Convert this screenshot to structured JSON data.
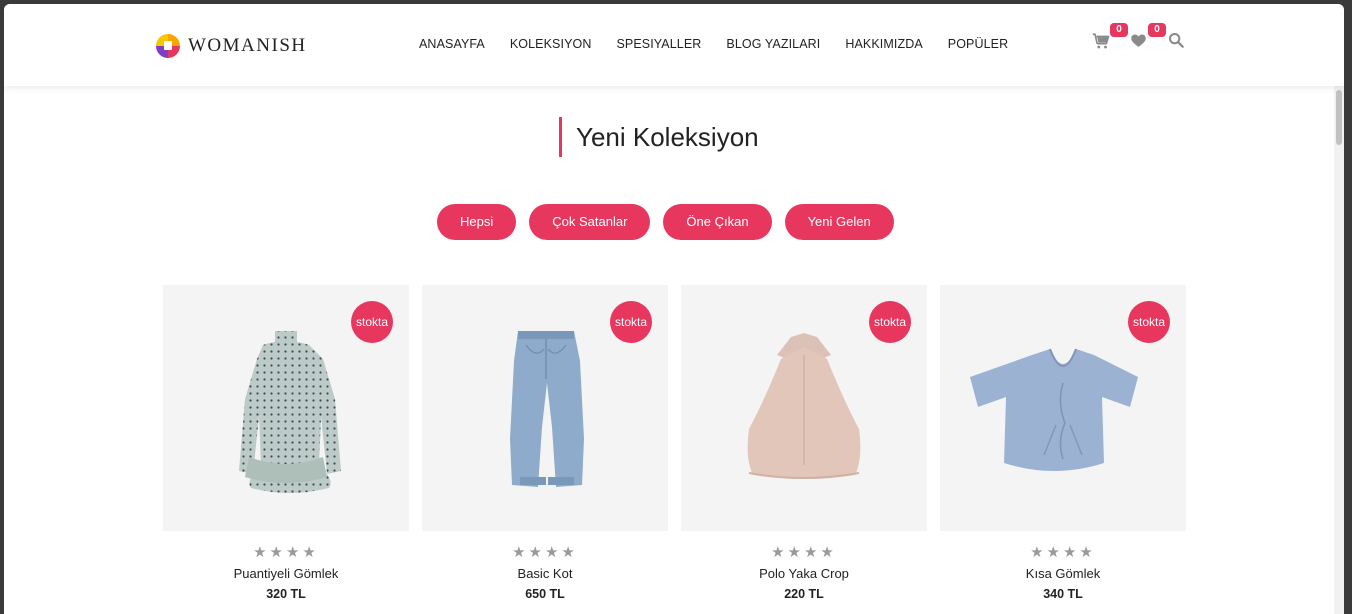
{
  "brand": {
    "name": "WOMANISH",
    "logo_icon": "womanish-logo-icon"
  },
  "nav": {
    "items": [
      {
        "label": "ANASAYFA"
      },
      {
        "label": "KOLEKSIYON"
      },
      {
        "label": "SPESIYALLER"
      },
      {
        "label": "BLOG YAZILARI"
      },
      {
        "label": "HAKKIMIZDA"
      },
      {
        "label": "POPÜLER"
      }
    ]
  },
  "header_icons": {
    "cart": {
      "icon": "cart-icon",
      "count": "0"
    },
    "wishlist": {
      "icon": "heart-icon",
      "count": "0"
    },
    "search": {
      "icon": "search-icon"
    }
  },
  "section": {
    "title": "Yeni Koleksiyon"
  },
  "filters": [
    {
      "label": "Hepsi"
    },
    {
      "label": "Çok Satanlar"
    },
    {
      "label": "Öne Çıkan"
    },
    {
      "label": "Yeni Gelen"
    }
  ],
  "products": [
    {
      "name": "Puantiyeli Gömlek",
      "price": "320 TL",
      "badge": "stokta",
      "stars": "★★★★",
      "image": "polka-dot-dress-image"
    },
    {
      "name": "Basic Kot",
      "price": "650 TL",
      "badge": "stokta",
      "stars": "★★★★",
      "image": "jeans-image"
    },
    {
      "name": "Polo Yaka Crop",
      "price": "220 TL",
      "badge": "stokta",
      "stars": "★★★★",
      "image": "halter-top-image"
    },
    {
      "name": "Kısa Gömlek",
      "price": "340 TL",
      "badge": "stokta",
      "stars": "★★★★",
      "image": "crop-tshirt-image"
    }
  ],
  "colors": {
    "accent": "#e8375f",
    "card_bg": "#f4f4f4",
    "star": "#9a9a9a"
  }
}
